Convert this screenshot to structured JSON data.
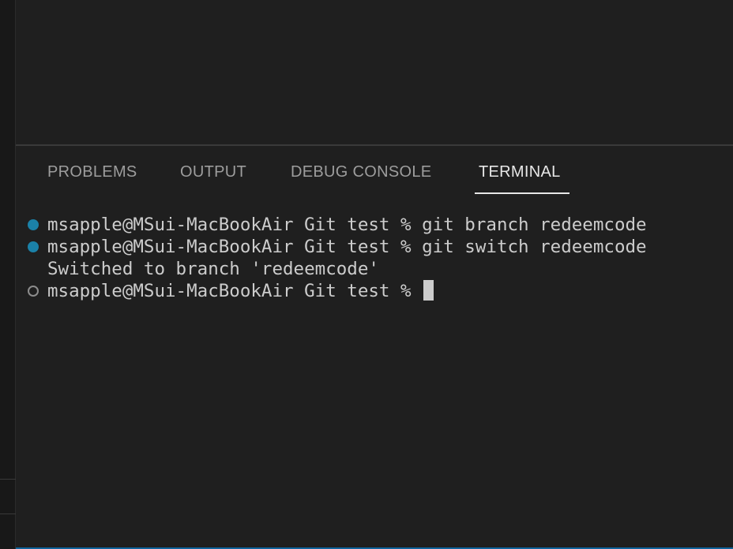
{
  "panel": {
    "tabs": [
      {
        "label": "PROBLEMS",
        "active": false
      },
      {
        "label": "OUTPUT",
        "active": false
      },
      {
        "label": "DEBUG CONSOLE",
        "active": false
      },
      {
        "label": "TERMINAL",
        "active": true
      }
    ]
  },
  "terminal": {
    "lines": [
      {
        "decoration": "success",
        "text": "msapple@MSui-MacBookAir Git test % git branch redeemcode"
      },
      {
        "decoration": "success",
        "text": "msapple@MSui-MacBookAir Git test % git switch redeemcode"
      },
      {
        "decoration": "none",
        "text": "Switched to branch 'redeemcode'"
      },
      {
        "decoration": "default",
        "text": "msapple@MSui-MacBookAir Git test % "
      }
    ]
  },
  "colors": {
    "background": "#1f1f1f",
    "tab_inactive": "#9d9d9d",
    "tab_active": "#e7e7e7",
    "success_decoration": "#1b81a8",
    "terminal_text": "#cccccc"
  }
}
